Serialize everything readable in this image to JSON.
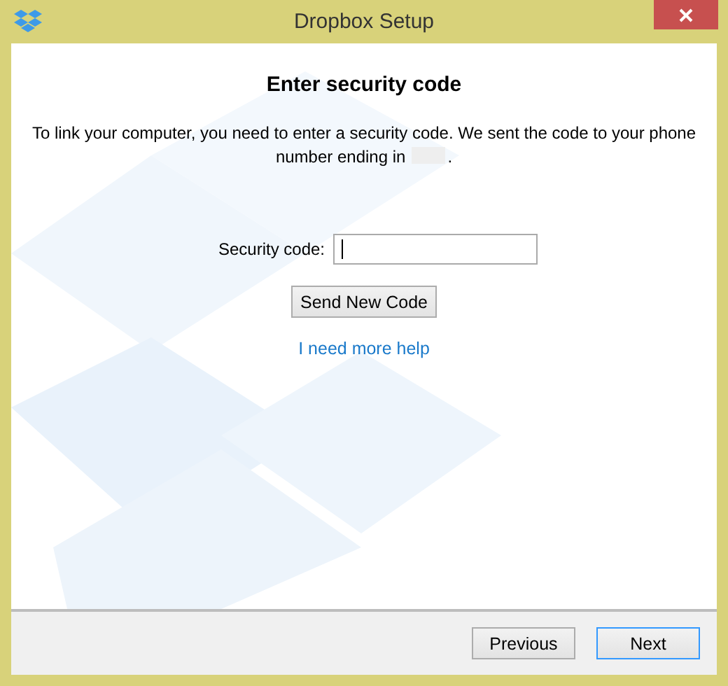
{
  "window": {
    "title": "Dropbox Setup"
  },
  "heading": "Enter security code",
  "message": {
    "text": "To link your computer, you need to enter a security code. We sent the code to your phone number ending in",
    "redacted": true,
    "end": "."
  },
  "field": {
    "label": "Security code:",
    "focused": true
  },
  "send_button": "Send New Code",
  "help_link": "I need more help",
  "footer_buttons": [
    {
      "label": "Previous",
      "default": false
    },
    {
      "label": "Next",
      "default": true
    }
  ]
}
